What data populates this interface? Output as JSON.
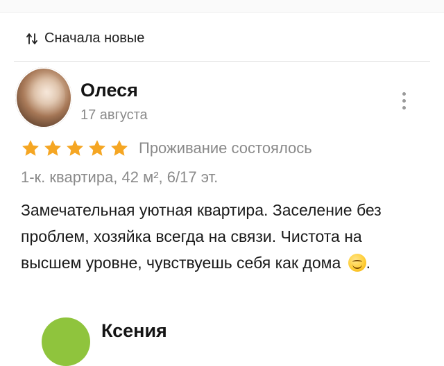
{
  "sort": {
    "label": "Сначала новые",
    "icon": "sort-arrows-icon"
  },
  "review": {
    "author": "Олеся",
    "date": "17 августа",
    "rating": 5,
    "rating_max": 5,
    "stay_status": "Проживание состоялось",
    "apartment": "1-к. квартира, 42 м², 6/17 эт.",
    "text": "Замечательная уютная квартира. Заселение без проблем, хозяйка всегда на связи. Чистота на высшем уровне, чувствуешь себя как дома",
    "text_end": ".",
    "more_icon": "more-vertical-icon",
    "emoji": "smiling-face-emoji"
  },
  "next_review": {
    "author": "Ксения"
  },
  "colors": {
    "star": "#f5a623",
    "muted_text": "#8a8a8a",
    "next_avatar": "#8fc43d"
  }
}
